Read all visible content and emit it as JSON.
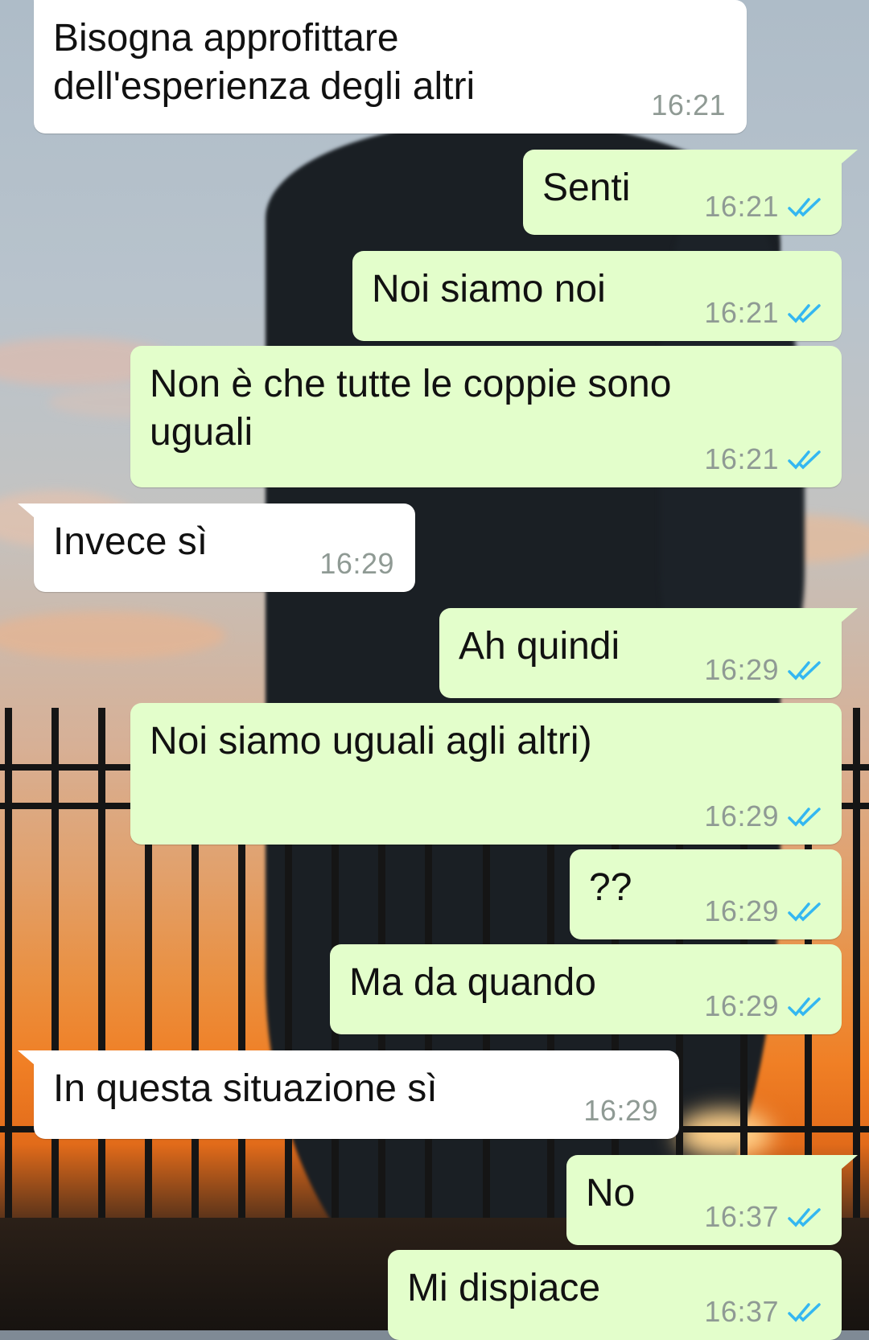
{
  "messages": [
    {
      "dir": "in",
      "text": "Bisogna approfittare\ndell'esperienza degli altri",
      "time": "16:21",
      "read": false
    },
    {
      "dir": "out",
      "text": "Senti",
      "time": "16:21",
      "read": true
    },
    {
      "dir": "out",
      "text": "Noi siamo noi",
      "time": "16:21",
      "read": true
    },
    {
      "dir": "out",
      "text": "Non è che tutte le coppie sono\nuguali",
      "time": "16:21",
      "read": true
    },
    {
      "dir": "in",
      "text": "Invece sì",
      "time": "16:29",
      "read": false
    },
    {
      "dir": "out",
      "text": "Ah quindi",
      "time": "16:29",
      "read": true
    },
    {
      "dir": "out",
      "text": "Noi siamo uguali agli altri)",
      "time": "16:29",
      "read": true
    },
    {
      "dir": "out",
      "text": "??",
      "time": "16:29",
      "read": true
    },
    {
      "dir": "out",
      "text": "Ma da quando",
      "time": "16:29",
      "read": true
    },
    {
      "dir": "in",
      "text": "In questa situazione sì",
      "time": "16:29",
      "read": false
    },
    {
      "dir": "out",
      "text": "No",
      "time": "16:37",
      "read": true
    },
    {
      "dir": "out",
      "text": "Mi dispiace",
      "time": "16:37",
      "read": true
    }
  ],
  "colors": {
    "incoming_bubble": "#ffffff",
    "outgoing_bubble": "#e3fecb",
    "read_ticks": "#34b7f1",
    "timestamp": "#8f9a94"
  },
  "icons": {
    "read_receipt": "double-check-icon"
  }
}
